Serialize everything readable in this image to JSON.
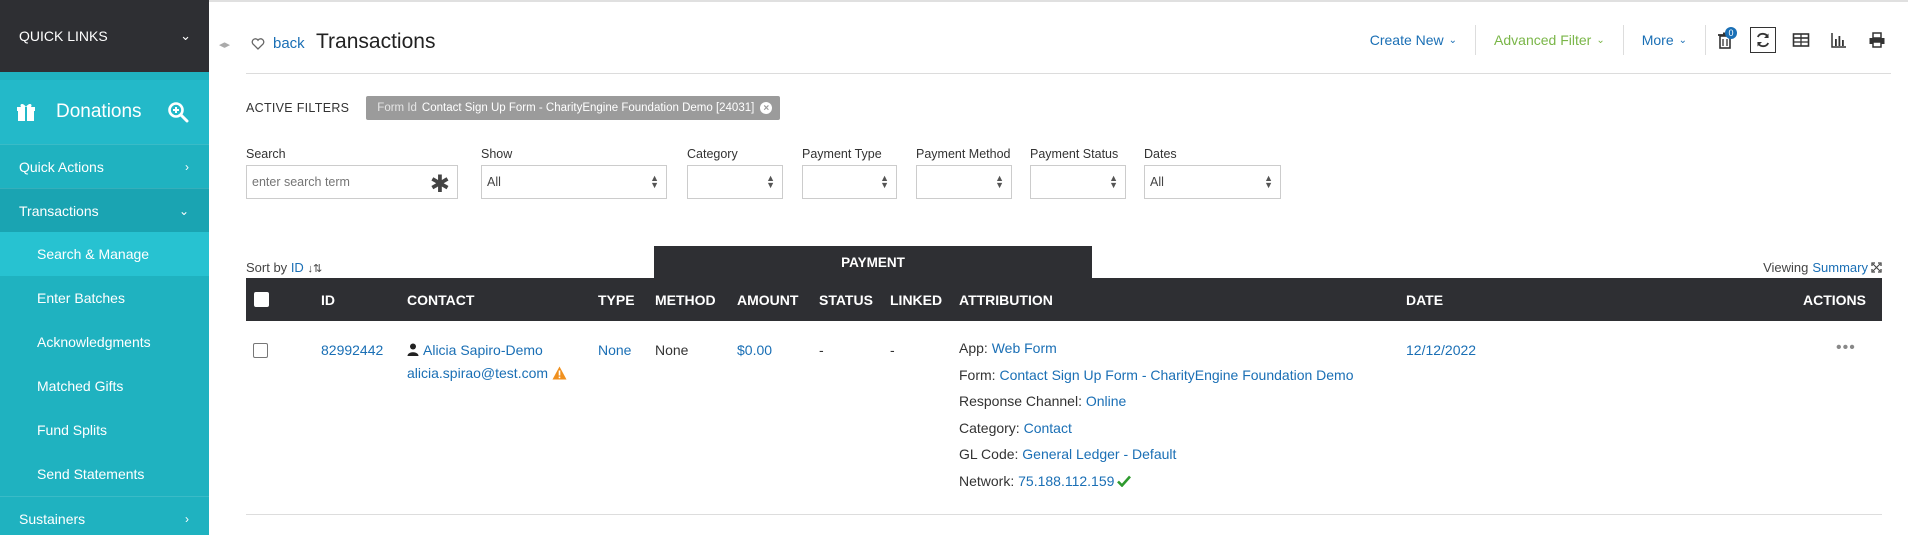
{
  "sidebar": {
    "quick_links": "QUICK LINKS",
    "module_title": "Donations",
    "items": [
      {
        "label": "Quick Actions"
      },
      {
        "label": "Transactions"
      },
      {
        "label": "Search & Manage"
      },
      {
        "label": "Enter Batches"
      },
      {
        "label": "Acknowledgments"
      },
      {
        "label": "Matched Gifts"
      },
      {
        "label": "Fund Splits"
      },
      {
        "label": "Send Statements"
      },
      {
        "label": "Sustainers"
      }
    ]
  },
  "header": {
    "back_label": "back",
    "title": "Transactions",
    "create_new": "Create New",
    "advanced_filter": "Advanced Filter",
    "more": "More",
    "delete_badge": "0"
  },
  "filters": {
    "active_label": "ACTIVE FILTERS",
    "chip_key": "Form Id",
    "chip_value": "Contact Sign Up Form - CharityEngine Foundation Demo [24031]",
    "search_label": "Search",
    "search_placeholder": "enter search term",
    "show_label": "Show",
    "show_value": "All",
    "category_label": "Category",
    "category_value": "",
    "payment_type_label": "Payment Type",
    "payment_type_value": "",
    "payment_method_label": "Payment Method",
    "payment_method_value": "",
    "payment_status_label": "Payment Status",
    "payment_status_value": "",
    "dates_label": "Dates",
    "dates_value": "All"
  },
  "table": {
    "sort_by_label": "Sort by",
    "sort_by_value": "ID",
    "viewing_label": "Viewing",
    "viewing_value": "Summary",
    "group_header": "PAYMENT",
    "columns": {
      "id": "ID",
      "contact": "CONTACT",
      "type": "TYPE",
      "method": "METHOD",
      "amount": "AMOUNT",
      "status": "STATUS",
      "linked": "LINKED",
      "attribution": "ATTRIBUTION",
      "date": "DATE",
      "actions": "ACTIONS"
    },
    "rows": [
      {
        "id": "82992442",
        "contact_name": "Alicia Sapiro-Demo",
        "contact_email": "alicia.spirao@test.com",
        "type": "None",
        "method": "None",
        "amount": "$0.00",
        "status": "-",
        "linked": "-",
        "attribution": {
          "app_label": "App:",
          "app_value": "Web Form",
          "form_label": "Form:",
          "form_value": "Contact Sign Up Form - CharityEngine Foundation Demo",
          "channel_label": "Response Channel:",
          "channel_value": "Online",
          "category_label": "Category:",
          "category_value": "Contact",
          "gl_label": "GL Code:",
          "gl_value": "General Ledger - Default",
          "network_label": "Network:",
          "network_value": "75.188.112.159"
        },
        "date": "12/12/2022",
        "actions": "•••"
      }
    ]
  },
  "colors": {
    "sidebar_bg": "#1fb2c0",
    "dark_bar": "#2e2f33",
    "link": "#1a6fb5",
    "accent_green": "#7ab648",
    "warning": "#f0901e",
    "success": "#2e9a2e"
  }
}
